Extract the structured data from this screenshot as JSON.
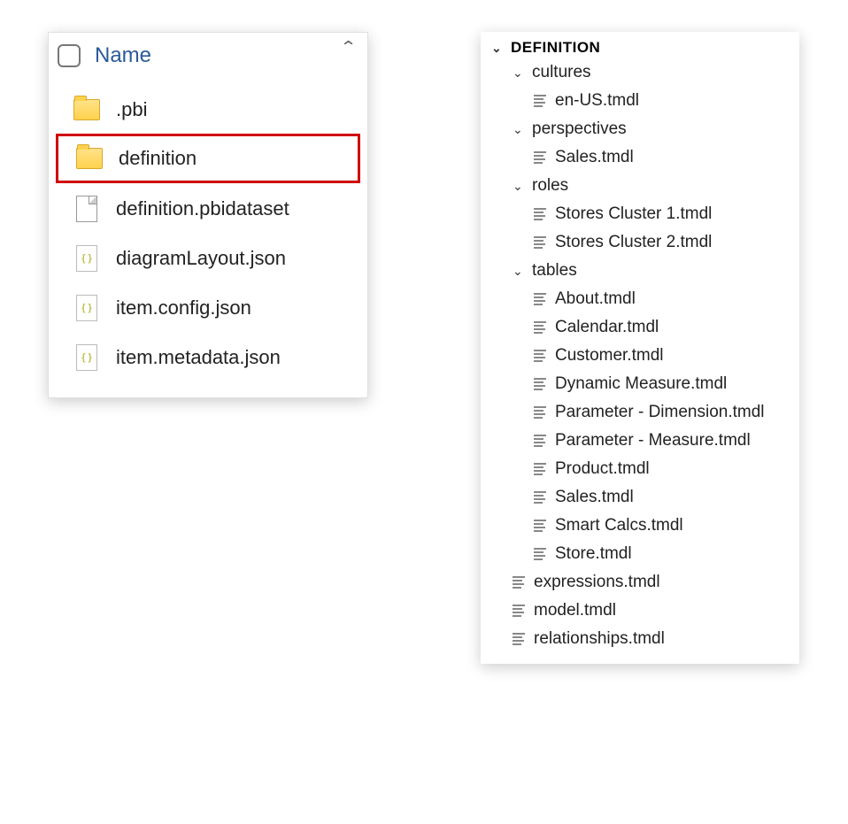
{
  "left_panel": {
    "header_label": "Name",
    "items": [
      {
        "type": "folder",
        "name": ".pbi",
        "highlighted": false
      },
      {
        "type": "folder",
        "name": "definition",
        "highlighted": true
      },
      {
        "type": "doc",
        "name": "definition.pbidataset",
        "highlighted": false
      },
      {
        "type": "json",
        "name": "diagramLayout.json",
        "highlighted": false
      },
      {
        "type": "json",
        "name": "item.config.json",
        "highlighted": false
      },
      {
        "type": "json",
        "name": "item.metadata.json",
        "highlighted": false
      }
    ]
  },
  "right_panel": {
    "root_label": "DEFINITION",
    "tree": [
      {
        "label": "cultures",
        "children": [
          {
            "label": "en-US.tmdl"
          }
        ]
      },
      {
        "label": "perspectives",
        "children": [
          {
            "label": "Sales.tmdl"
          }
        ]
      },
      {
        "label": "roles",
        "children": [
          {
            "label": "Stores Cluster 1.tmdl"
          },
          {
            "label": "Stores Cluster 2.tmdl"
          }
        ]
      },
      {
        "label": "tables",
        "children": [
          {
            "label": "About.tmdl"
          },
          {
            "label": "Calendar.tmdl"
          },
          {
            "label": "Customer.tmdl"
          },
          {
            "label": "Dynamic Measure.tmdl"
          },
          {
            "label": "Parameter - Dimension.tmdl"
          },
          {
            "label": "Parameter - Measure.tmdl"
          },
          {
            "label": "Product.tmdl"
          },
          {
            "label": "Sales.tmdl"
          },
          {
            "label": "Smart Calcs.tmdl"
          },
          {
            "label": "Store.tmdl"
          }
        ]
      },
      {
        "label": "expressions.tmdl"
      },
      {
        "label": "model.tmdl"
      },
      {
        "label": "relationships.tmdl"
      }
    ]
  }
}
